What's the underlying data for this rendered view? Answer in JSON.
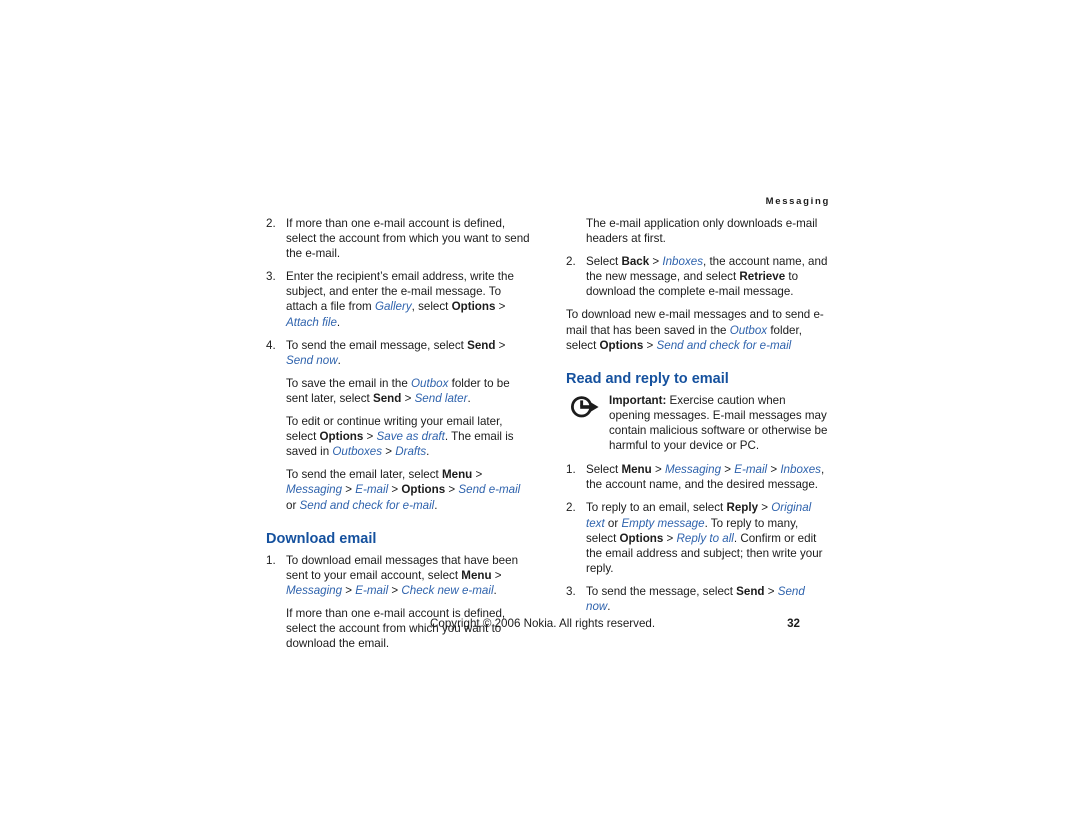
{
  "document": {
    "running_header": "Messaging",
    "page_number": "32",
    "copyright": "Copyright © 2006 Nokia. All rights reserved.",
    "heading_color": "#15519e",
    "link_color": "#2f63ad",
    "body_color": "#1c1c1c"
  },
  "left_column": {
    "item2": {
      "num": "2.",
      "text": "If more than one e-mail account is defined, select the account from which you want to send the e-mail."
    },
    "item3": {
      "num": "3.",
      "t1": "Enter the recipient’s email address, write the subject, and enter the e-mail message. To attach a file from ",
      "link1": "Gallery",
      "t2": ", select ",
      "bold1": "Options",
      "t3": " > ",
      "link2": "Attach file",
      "t4": "."
    },
    "item4": {
      "num": "4.",
      "t1": "To send the email message, select ",
      "bold1": "Send",
      "t2": " > ",
      "link1": "Send now",
      "t3": "."
    },
    "cont1": {
      "t1": "To save the email in the ",
      "link1": "Outbox",
      "t2": " folder to be sent later, select ",
      "bold1": "Send",
      "t3": " > ",
      "link2": "Send later",
      "t4": "."
    },
    "cont2": {
      "t1": "To edit or continue writing your email later, select ",
      "bold1": "Options",
      "t2": " > ",
      "link1": "Save as draft",
      "t3": ". The email is saved in ",
      "link2": "Outboxes",
      "t4": " > ",
      "link3": "Drafts",
      "t5": "."
    },
    "cont3": {
      "t1": "To send the email later, select ",
      "bold1": "Menu",
      "t2": " > ",
      "link1": "Messaging",
      "t3": " > ",
      "link2": "E-mail",
      "t4": " > ",
      "bold2": "Options",
      "t5": " > ",
      "link3": "Send e-mail",
      "t6": " or ",
      "link4": "Send and check for e-mail",
      "t7": "."
    },
    "heading_download": "Download email",
    "download_item1": {
      "num": "1.",
      "t1": "To download email messages that have been sent to your email account, select ",
      "bold1": "Menu",
      "t2": " > ",
      "link1": "Messaging",
      "t3": " > ",
      "link2": "E-mail",
      "t4": " > ",
      "link3": "Check new e-mail",
      "t5": "."
    },
    "download_cont": {
      "text": "If more than one e-mail account is defined, select the account from which you want to download the email."
    }
  },
  "right_column": {
    "intro": {
      "text": "The e-mail application only downloads e-mail headers at first."
    },
    "item2": {
      "num": "2.",
      "t1": "Select ",
      "bold1": "Back",
      "t2": " > ",
      "link1": "Inboxes",
      "t3": ", the account name, and the new message, and select ",
      "bold2": "Retrieve",
      "t4": " to download the complete e-mail message."
    },
    "para_download": {
      "t1": "To download new e-mail messages and to send e-mail that has been saved in the ",
      "link1": "Outbox",
      "t2": " folder, select ",
      "bold1": "Options",
      "t3": " > ",
      "link2": "Send and check for e-mail"
    },
    "heading_read": "Read and reply to email",
    "note": {
      "icon": "important-arrow-icon",
      "label": "Important:",
      "text": " Exercise caution when opening messages. E-mail messages may contain malicious software or otherwise be harmful to your device or PC."
    },
    "item1": {
      "num": "1.",
      "t1": "Select ",
      "bold1": "Menu",
      "t2": " > ",
      "link1": "Messaging",
      "t3": " > ",
      "link2": "E-mail",
      "t4": " > ",
      "link3": "Inboxes",
      "t5": ", the account name, and the desired message."
    },
    "item2b": {
      "num": "2.",
      "t1": "To reply to an email, select ",
      "bold1": "Reply",
      "t2": " > ",
      "link1": "Original text",
      "t3": " or ",
      "link2": "Empty message",
      "t4": ". To reply to many, select ",
      "bold2": "Options",
      "t5": " > ",
      "link3": "Reply to all",
      "t6": ". Confirm or edit the email address and subject; then write your reply."
    },
    "item3b": {
      "num": "3.",
      "t1": "To send the message, select ",
      "bold1": "Send",
      "t2": " > ",
      "link1": "Send now",
      "t3": "."
    }
  }
}
